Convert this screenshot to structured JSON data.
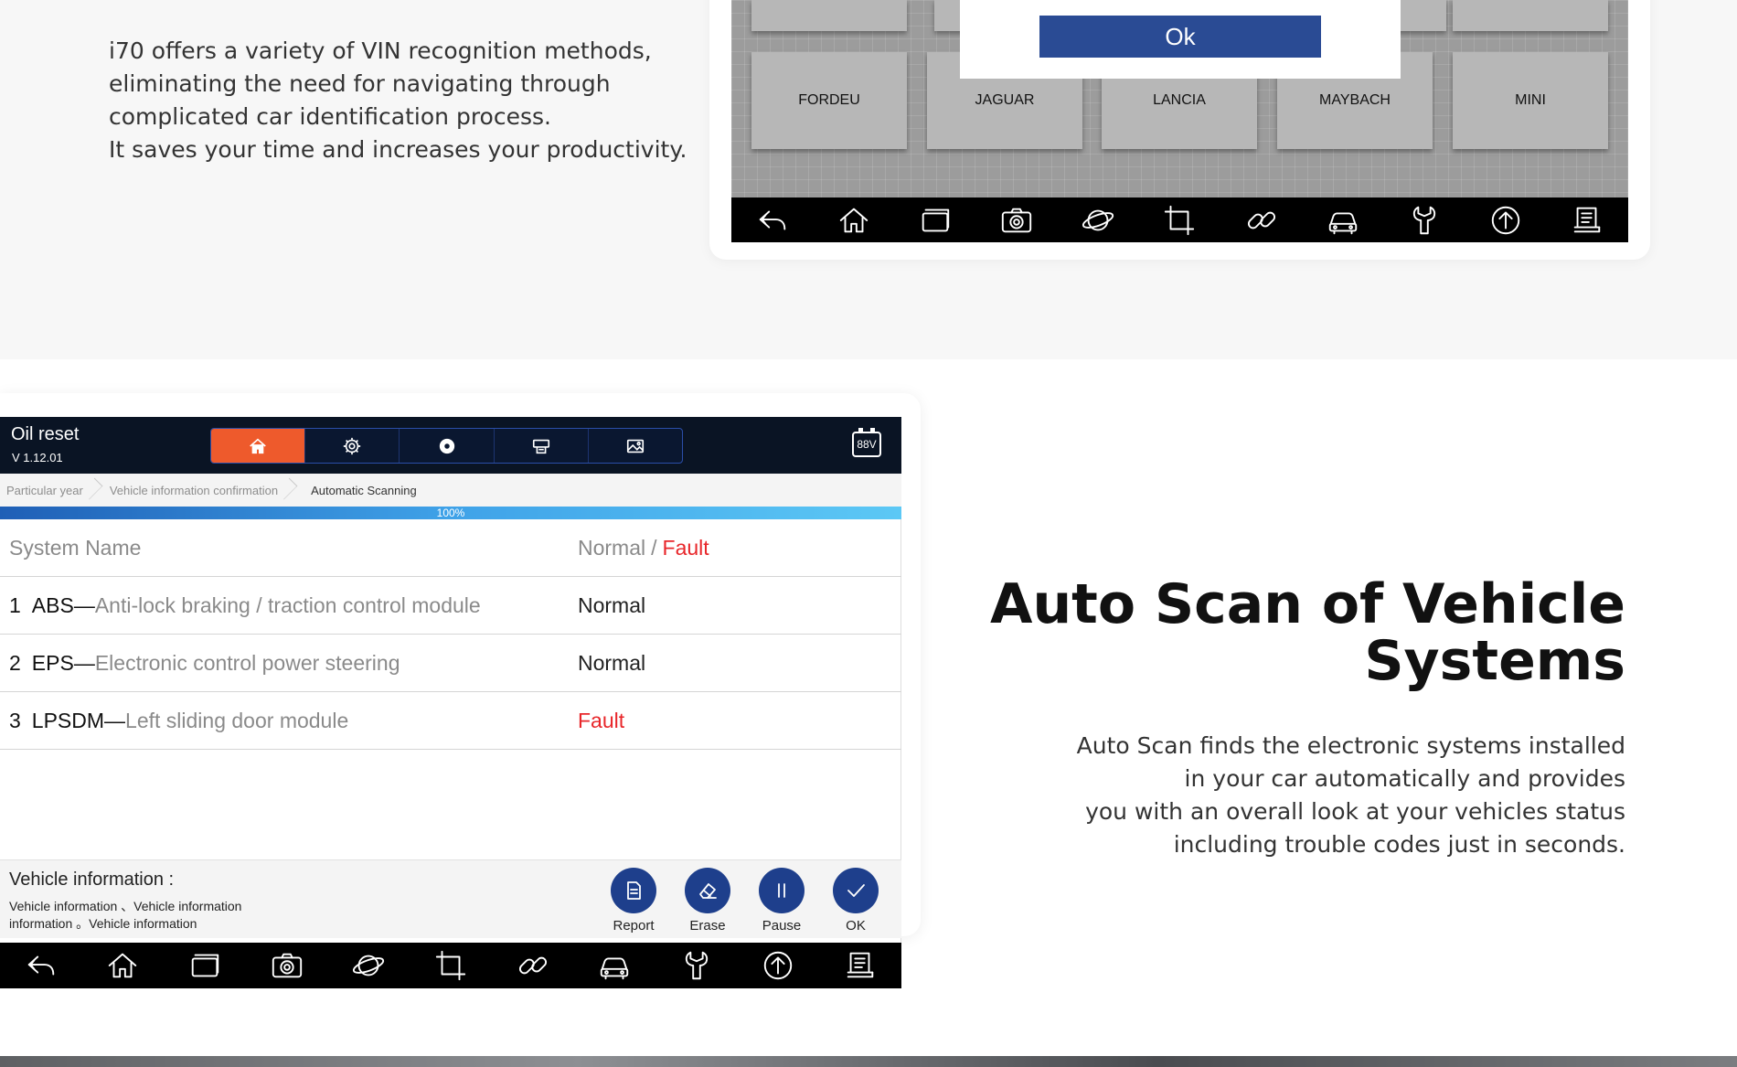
{
  "intro": {
    "lines": [
      "i70 offers a variety of VIN recognition methods,",
      "eliminating the need for navigating through",
      "complicated car identification process.",
      "It saves your time and increases your productivity."
    ]
  },
  "brand_screen": {
    "brands": [
      "FORDEU",
      "JAGUAR",
      "LANCIA",
      "MAYBACH",
      "MINI"
    ],
    "dialog_ok_label": "Ok"
  },
  "nav_icons": [
    "back-icon",
    "home-icon",
    "recent-apps-icon",
    "camera-icon",
    "browser-globe-icon",
    "crop-icon",
    "link-icon",
    "car-icon",
    "wrench-icon",
    "upload-icon",
    "book-icon"
  ],
  "scan_app": {
    "title": "Oil reset",
    "version": "V 1.12.01",
    "tab_icons": [
      "home-icon",
      "settings-icon",
      "record-icon",
      "printer-icon",
      "gallery-icon"
    ],
    "battery": "88V",
    "breadcrumb": [
      "Particular year",
      "Vehicle information confirmation",
      "Automatic Scanning"
    ],
    "progress_label": "100%",
    "progress_value": 100,
    "table": {
      "header_name": "System Name",
      "header_normal": "Normal",
      "header_separator": "/",
      "header_fault": "Fault",
      "rows": [
        {
          "num": "1",
          "code": "ABS—",
          "desc": "Anti-lock braking / traction control module",
          "status": "Normal"
        },
        {
          "num": "2",
          "code": "EPS—",
          "desc": "Electronic control power steering",
          "status": "Normal"
        },
        {
          "num": "3",
          "code": "LPSDM—",
          "desc": "Left sliding door module",
          "status": "Fault"
        }
      ]
    },
    "vehicle_info": {
      "title": "Vehicle information :",
      "line1": "Vehicle information 、Vehicle information",
      "line2": "information 。Vehicle information"
    },
    "actions": [
      {
        "label": "Report",
        "icon": "report-icon"
      },
      {
        "label": "Erase",
        "icon": "eraser-icon"
      },
      {
        "label": "Pause",
        "icon": "pause-icon"
      },
      {
        "label": "OK",
        "icon": "check-icon"
      }
    ]
  },
  "feature": {
    "title_line1": "Auto Scan of Vehicle",
    "title_line2": "Systems",
    "desc_lines": [
      "Auto Scan finds the electronic systems installed",
      "in your car automatically and provides",
      "you with an overall look at your vehicles status",
      "including trouble codes just in seconds."
    ]
  },
  "colors": {
    "accent_blue": "#2a4b94",
    "tab_active": "#ee5a2c",
    "fault_red": "#e8262a"
  }
}
